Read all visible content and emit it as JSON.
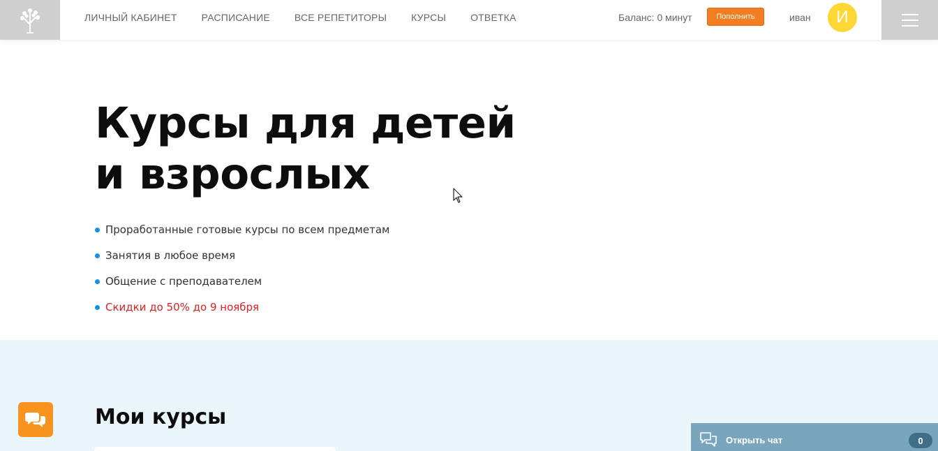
{
  "header": {
    "nav": [
      {
        "label": "ЛИЧНЫЙ КАБИНЕТ"
      },
      {
        "label": "РАСПИСАНИЕ"
      },
      {
        "label": "ВСЕ РЕПЕТИТОРЫ"
      },
      {
        "label": "КУРСЫ"
      },
      {
        "label": "ОТВЕТКА"
      }
    ],
    "balance": "Баланс: 0 минут",
    "topup_label": "Пополнить",
    "username": "иван",
    "avatar_letter": "И",
    "logo_icon": "tree-icon",
    "menu_icon": "hamburger-menu-icon"
  },
  "hero": {
    "title_line1": "Курсы для детей",
    "title_line2": "и взрослых",
    "bullets": [
      {
        "text": "Проработанные готовые курсы по всем предметам"
      },
      {
        "text": "Занятия в любое время"
      },
      {
        "text": "Общение с преподавателем"
      },
      {
        "text": "Скидки до 50% до 9 ноября"
      }
    ]
  },
  "courses": {
    "title": "Мои курсы"
  },
  "chat": {
    "label": "Открыть чат",
    "count": "0",
    "fab_icon": "chat-bubbles-icon"
  },
  "colors": {
    "accent_orange": "#f47d20",
    "bullet_blue": "#1a8fe3",
    "promo_red": "#e02020",
    "section_bg": "#eaf5fc",
    "chat_bar": "#7aa6bd",
    "avatar_yellow": "#fdd835"
  }
}
